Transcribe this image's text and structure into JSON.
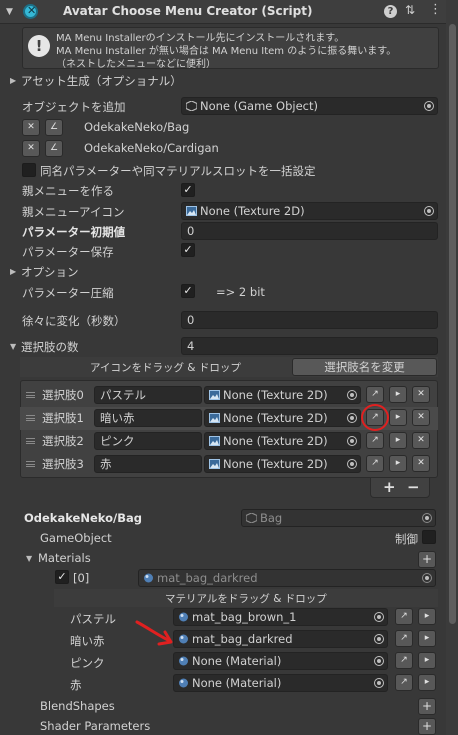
{
  "header": {
    "title": "Avatar Choose Menu Creator (Script)"
  },
  "info": {
    "line1": "MA Menu Installerのインストール先にインストールされます。",
    "line2": "MA Menu Installer が無い場合は MA Menu Item のように振る舞います。",
    "line3": "（ネストしたメニューなどに便利）"
  },
  "asset_gen": {
    "label": "アセット生成（オプショナル）"
  },
  "add_object": {
    "label": "オブジェクトを追加",
    "value": "None (Game Object)"
  },
  "objects": [
    "OdekakeNeko/Bag",
    "OdekakeNeko/Cardigan"
  ],
  "bulk_setting": {
    "label": "同名パラメーターや同マテリアルスロットを一括設定",
    "checked": false
  },
  "parent_menu": {
    "label": "親メニューを作る",
    "checked": true
  },
  "parent_icon": {
    "label": "親メニューアイコン",
    "value": "None (Texture 2D)"
  },
  "param_initial": {
    "label": "パラメーター初期値",
    "value": "0"
  },
  "param_save": {
    "label": "パラメーター保存",
    "checked": true
  },
  "options": {
    "label": "オプション"
  },
  "param_compress": {
    "label": "パラメーター圧縮",
    "checked": true,
    "note": "=> 2 bit"
  },
  "gradual": {
    "label": "徐々に変化（秒数）",
    "value": "0"
  },
  "choice_count": {
    "label": "選択肢の数",
    "value": "4"
  },
  "choices_header": {
    "drag_label": "アイコンをドラッグ & ドロップ",
    "rename_button": "選択肢名を変更"
  },
  "choices": [
    {
      "label": "選択肢0",
      "name": "パステル",
      "icon": "None (Texture 2D)"
    },
    {
      "label": "選択肢1",
      "name": "暗い赤",
      "icon": "None (Texture 2D)"
    },
    {
      "label": "選択肢2",
      "name": "ピンク",
      "icon": "None (Texture 2D)"
    },
    {
      "label": "選択肢3",
      "name": "赤",
      "icon": "None (Texture 2D)"
    }
  ],
  "list_buttons": {
    "add": "+",
    "remove": "−"
  },
  "object_section": {
    "title": "OdekakeNeko/Bag",
    "ref": "Bag",
    "gameobject_label": "GameObject",
    "control_label": "制御",
    "materials_label": "Materials",
    "material_slot": {
      "index": "[0]",
      "value": "mat_bag_darkred"
    },
    "material_drag_label": "マテリアルをドラッグ & ドロップ",
    "material_rows": [
      {
        "label": "パステル",
        "value": "mat_bag_brown_1"
      },
      {
        "label": "暗い赤",
        "value": "mat_bag_darkred"
      },
      {
        "label": "ピンク",
        "value": "None (Material)"
      },
      {
        "label": "赤",
        "value": "None (Material)"
      }
    ],
    "blendshapes_label": "BlendShapes",
    "shader_params_label": "Shader Parameters"
  },
  "colors": {
    "annotation": "#e02020",
    "panel": "#383838",
    "field": "#2a2a2a"
  }
}
